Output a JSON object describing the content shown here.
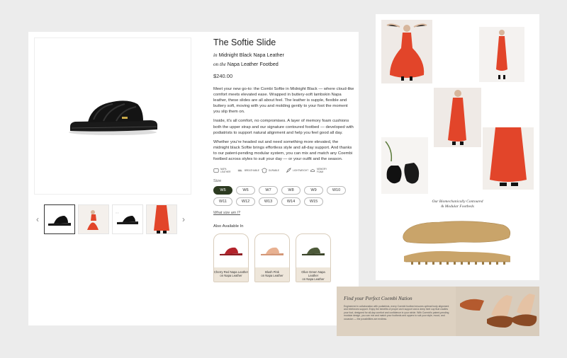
{
  "product": {
    "title": "The Softie Slide",
    "in_prefix": "in",
    "color": "Midnight Black Napa Leather",
    "on_prefix": "on the",
    "footbed": "Napa Leather Footbed",
    "price": "$240.00",
    "description": [
      "Meet your new go-to: the Combi Softie in Midnight Black — where cloud-like comfort meets elevated ease. Wrapped in buttery-soft lambskin Napa leather, these slides are all about feel. The leather is supple, flexible and buttery soft, moving with you and molding gently to your foot the moment you slip them on.",
      "Inside, it's all comfort, no compromises. A layer of memory foam cushions both the upper strap and our signature contoured footbed — developed with podiatrists to support natural alignment and help you feel good all day.",
      "Whether you're headed out and need something more elevated, the midnight black Softie brings effortless style and all-day support. And thanks to our patent-pending modular system, you can mix and match any Coembi footbed across styles to suit your day — or your outfit and the season."
    ],
    "features": [
      "Napa Leather",
      "Breathable",
      "Durable",
      "Lightweight",
      "Memory Foam"
    ],
    "size_label": "Size",
    "sizes": [
      "W5",
      "W6",
      "W7",
      "W8",
      "W9",
      "W10",
      "W11",
      "W12",
      "W13",
      "W14",
      "W15"
    ],
    "selected_size": "W5",
    "fit_link": "What size am I?",
    "also_label": "Also Available In",
    "variants": [
      {
        "name": "Cherry Red Napa Leather",
        "sub": "on Napa Leather",
        "color": "#b3232b"
      },
      {
        "name": "Blush Pink",
        "sub": "on Napa Leather",
        "color": "#e8b191"
      },
      {
        "name": "Olive Green Napa Leather",
        "sub": "on Napa Leather",
        "color": "#4d5a3a"
      }
    ]
  },
  "panel": {
    "diagram_title_1": "Our Biomechanically Contoured",
    "diagram_title_2": "& Modular Footbeds"
  },
  "banner": {
    "title": "Find your Perfect Coembi Nation",
    "text": "Engineered in collaboration with podiatrists, every Coembi footbed ensures optimal body alignment and reinforces support. Enjoy the benefits of proper arch support and a deep heel cup that cradles your foot, designed for all-day comfort and confidence in your stride. With Coembi's patent-pending modular design, you can mix and match your footbeds and uppers to suit your style, mood, and occasion — the possibilities are endless."
  },
  "colors": {
    "accent": "#2c3a20",
    "dress": "#e2452a",
    "cork": "#c9a46a"
  }
}
